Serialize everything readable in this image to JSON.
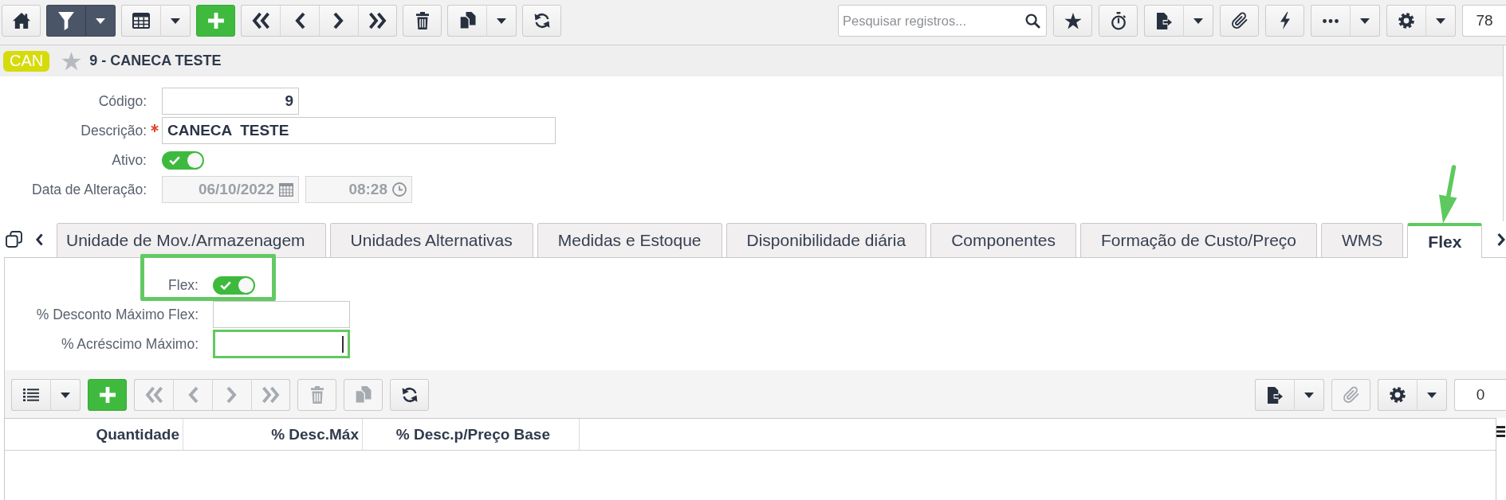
{
  "toolbar": {
    "left": [
      {
        "kind": "home",
        "dropdown": false,
        "active": false
      },
      {
        "kind": "filter",
        "dropdown": true,
        "active": true
      },
      {
        "kind": "view",
        "dropdown": true,
        "active": false
      },
      {
        "kind": "add",
        "dropdown": false,
        "active": false
      },
      {
        "kind": "first",
        "dropdown": false,
        "active": false
      },
      {
        "kind": "previous",
        "dropdown": false,
        "active": false
      },
      {
        "kind": "next",
        "dropdown": false,
        "active": false
      },
      {
        "kind": "last",
        "dropdown": false,
        "active": false
      },
      {
        "kind": "delete",
        "dropdown": false,
        "active": false
      },
      {
        "kind": "duplicate",
        "dropdown": true,
        "active": false
      },
      {
        "kind": "refresh",
        "dropdown": false,
        "active": false
      }
    ],
    "search": {
      "placeholder": "Pesquisar registros..."
    },
    "right": [
      {
        "kind": "favorite",
        "dropdown": false,
        "active": false
      },
      {
        "kind": "timer",
        "dropdown": false,
        "active": false
      },
      {
        "kind": "export",
        "dropdown": true,
        "active": false
      },
      {
        "kind": "attach",
        "dropdown": false,
        "active": false
      },
      {
        "kind": "actions",
        "dropdown": false,
        "active": false
      },
      {
        "kind": "more",
        "dropdown": true,
        "active": false
      },
      {
        "kind": "settings",
        "dropdown": true,
        "active": false
      }
    ],
    "record_count": "78"
  },
  "record": {
    "badge": "CAN",
    "favorite": false,
    "title": "9 - CANECA TESTE"
  },
  "form": {
    "fields": [
      {
        "kind": "number",
        "label": "Código:",
        "value": "9",
        "required": false,
        "disabled": false
      },
      {
        "kind": "text",
        "label": "Descrição:",
        "value": "CANECA  TESTE",
        "required": true,
        "disabled": false
      },
      {
        "kind": "toggle",
        "label": "Ativo:",
        "on": true,
        "required": false,
        "disabled": false
      },
      {
        "kind": "datetime",
        "label": "Data de Alteração:",
        "date": "06/10/2022",
        "time": "08:28",
        "required": false,
        "disabled": true
      }
    ]
  },
  "tabs": [
    {
      "label": "Unidade de Mov./Armazenagem",
      "selected": false,
      "marked": false
    },
    {
      "label": "Unidades Alternativas",
      "selected": false,
      "marked": false
    },
    {
      "label": "Medidas e Estoque",
      "selected": false,
      "marked": false
    },
    {
      "label": "Disponibilidade diária",
      "selected": false,
      "marked": false
    },
    {
      "label": "Componentes",
      "selected": false,
      "marked": false
    },
    {
      "label": "Formação de Custo/Preço",
      "selected": false,
      "marked": false
    },
    {
      "label": "WMS",
      "selected": false,
      "marked": false
    },
    {
      "label": "Flex",
      "selected": true,
      "marked": true
    }
  ],
  "flex": {
    "fields": [
      {
        "kind": "toggle",
        "label": "Flex:",
        "on": true,
        "highlighted": true
      },
      {
        "kind": "text",
        "label": "% Desconto Máximo Flex:",
        "highlighted": false,
        "focused": false
      },
      {
        "kind": "text",
        "label": "% Acréscimo Máximo:",
        "highlighted": true,
        "focused": true
      }
    ]
  },
  "grid_toolbar": {
    "left": [
      {
        "kind": "list",
        "dropdown": true,
        "disabled": false
      },
      {
        "kind": "add",
        "dropdown": false,
        "disabled": false
      },
      {
        "kind": "first",
        "dropdown": false,
        "disabled": true
      },
      {
        "kind": "previous",
        "dropdown": false,
        "disabled": true
      },
      {
        "kind": "next",
        "dropdown": false,
        "disabled": true
      },
      {
        "kind": "last",
        "dropdown": false,
        "disabled": true
      },
      {
        "kind": "delete",
        "dropdown": false,
        "disabled": true
      },
      {
        "kind": "duplicate",
        "dropdown": false,
        "disabled": true
      },
      {
        "kind": "refresh",
        "dropdown": false,
        "disabled": false
      }
    ],
    "right": [
      {
        "kind": "export",
        "dropdown": true,
        "disabled": false
      },
      {
        "kind": "attach",
        "dropdown": false,
        "disabled": true
      },
      {
        "kind": "settings",
        "dropdown": true,
        "disabled": false
      }
    ],
    "record_count": "0"
  },
  "grid": {
    "columns": [
      {
        "label": "Quantidade"
      },
      {
        "label": "% Desc.Máx"
      },
      {
        "label": "% Desc.p/Preço Base"
      }
    ]
  }
}
